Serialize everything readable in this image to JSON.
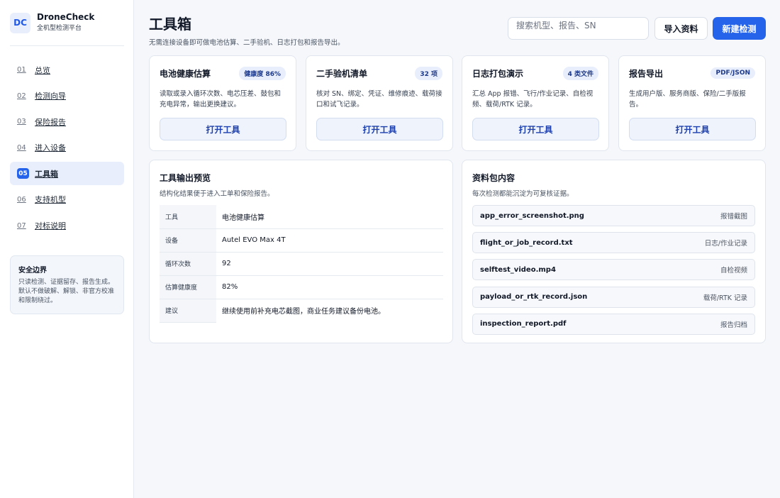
{
  "brand": {
    "logo": "DC",
    "name": "DroneCheck",
    "subtitle": "全机型检测平台"
  },
  "nav": [
    {
      "num": "01",
      "label": "总览",
      "active": false
    },
    {
      "num": "02",
      "label": "检测向导",
      "active": false
    },
    {
      "num": "03",
      "label": "保险报告",
      "active": false
    },
    {
      "num": "04",
      "label": "进入设备",
      "active": false
    },
    {
      "num": "05",
      "label": "工具箱",
      "active": true
    },
    {
      "num": "06",
      "label": "支持机型",
      "active": false
    },
    {
      "num": "07",
      "label": "对标说明",
      "active": false
    }
  ],
  "safety": {
    "title": "安全边界",
    "text": "只读检测、证据留存、报告生成。默认不做破解、解锁、非官方校准和限制绕过。"
  },
  "header": {
    "title": "工具箱",
    "subtitle": "无需连接设备即可做电池估算、二手验机、日志打包和报告导出。",
    "search_placeholder": "搜索机型、报告、SN",
    "import_label": "导入资料",
    "new_label": "新建检测"
  },
  "tools": [
    {
      "title": "电池健康估算",
      "badge": "健康度 86%",
      "desc": "读取或录入循环次数、电芯压差、鼓包和充电异常，输出更换建议。",
      "button": "打开工具"
    },
    {
      "title": "二手验机清单",
      "badge": "32 项",
      "desc": "核对 SN、绑定、凭证、维修痕迹、载荷接口和试飞记录。",
      "button": "打开工具"
    },
    {
      "title": "日志打包演示",
      "badge": "4 类文件",
      "desc": "汇总 App 报错、飞行/作业记录、自检视频、载荷/RTK 记录。",
      "button": "打开工具"
    },
    {
      "title": "报告导出",
      "badge": "PDF/JSON",
      "desc": "生成用户版、服务商版、保险/二手版报告。",
      "button": "打开工具"
    }
  ],
  "output_preview": {
    "title": "工具输出预览",
    "subtitle": "结构化结果便于进入工单和保险报告。",
    "rows": [
      {
        "key": "工具",
        "value": "电池健康估算"
      },
      {
        "key": "设备",
        "value": "Autel EVO Max 4T"
      },
      {
        "key": "循环次数",
        "value": "92"
      },
      {
        "key": "估算健康度",
        "value": "82%"
      },
      {
        "key": "建议",
        "value": "继续使用前补充电芯截图，商业任务建议备份电池。"
      }
    ]
  },
  "package": {
    "title": "资料包内容",
    "subtitle": "每次检测都能沉淀为可复核证据。",
    "files": [
      {
        "name": "app_error_screenshot.png",
        "tag": "报错截图"
      },
      {
        "name": "flight_or_job_record.txt",
        "tag": "日志/作业记录"
      },
      {
        "name": "selftest_video.mp4",
        "tag": "自检视频"
      },
      {
        "name": "payload_or_rtk_record.json",
        "tag": "载荷/RTK 记录"
      },
      {
        "name": "inspection_report.pdf",
        "tag": "报告归档"
      }
    ]
  },
  "colors": {
    "accent": "#2563eb",
    "badge_bg": "#e8eefb",
    "background": "#f5f7fb"
  }
}
